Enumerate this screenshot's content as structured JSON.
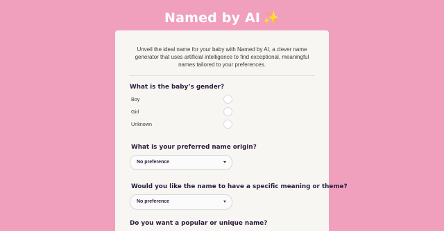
{
  "header": {
    "title": "Named by AI",
    "emoji": "✨"
  },
  "intro": "Unveil the ideal name for your baby with Named by AI, a clever name generator that uses artificial intelligence to find exceptional, meaningful names tailored to your preferences.",
  "gender": {
    "question": "What is the baby’s gender?",
    "options": [
      "Boy",
      "Girl",
      "Unknown"
    ]
  },
  "origin": {
    "question": "What is your preferred name origin?",
    "selected": "No preference"
  },
  "meaning": {
    "question": "Would you like the name to have a specific meaning or theme?",
    "selected": "No preference"
  },
  "popularity": {
    "question": "Do you want a popular or unique name?"
  },
  "colors": {
    "background": "#f0a0bd",
    "card": "#f8f6f3",
    "heading": "#2b1b3d"
  }
}
